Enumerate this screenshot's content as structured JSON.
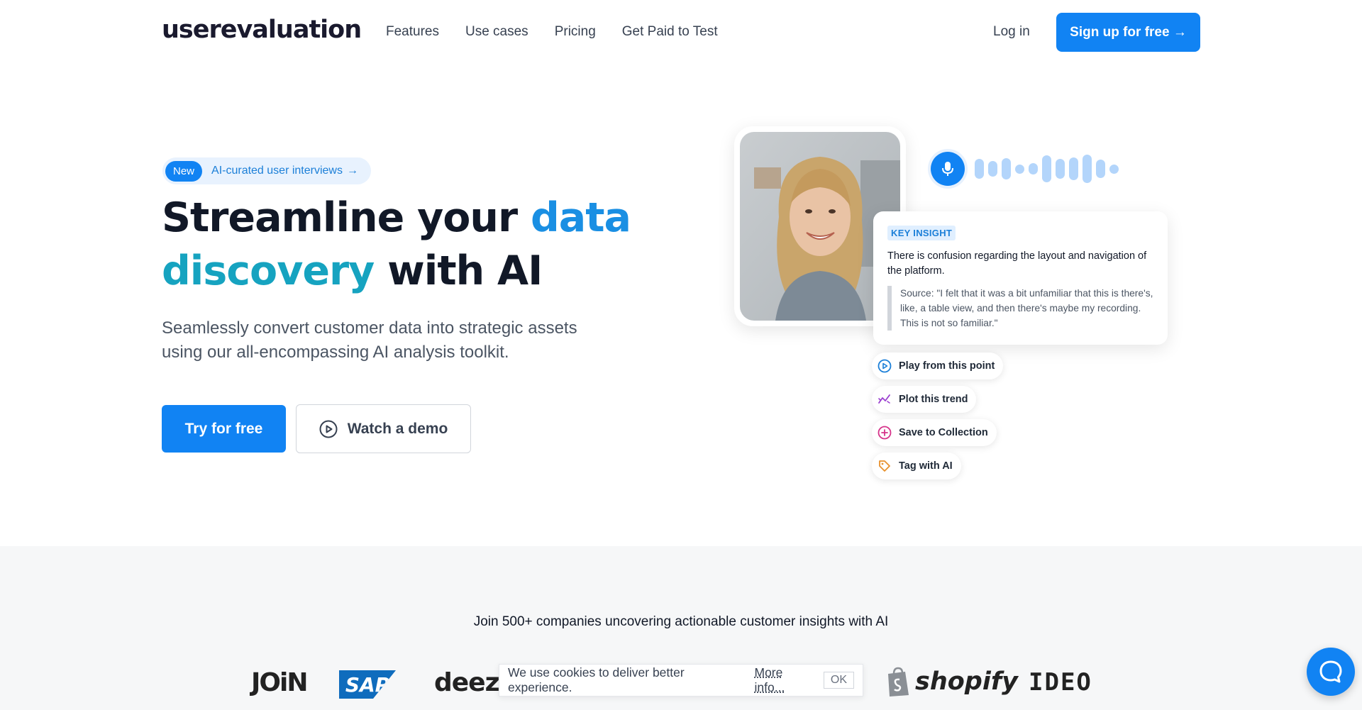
{
  "nav": {
    "logo": "userevaluation",
    "links": [
      "Features",
      "Use cases",
      "Pricing",
      "Get Paid to Test"
    ],
    "login": "Log in",
    "signup": "Sign up for free →"
  },
  "hero": {
    "badge_new": "New",
    "badge_text": "AI-curated user interviews",
    "headline_1": "Streamline your ",
    "headline_2": "data",
    "headline_3": "discovery",
    "headline_4": " with AI",
    "subtext": "Seamlessly convert customer data into strategic assets using our all-encompassing AI analysis toolkit.",
    "try_button": "Try for free",
    "demo_button": "Watch a demo"
  },
  "insight": {
    "tag": "KEY INSIGHT",
    "title": "There is confusion regarding the layout and navigation of the platform.",
    "quote": "Source: \"I felt that it was a bit unfamiliar that this is there's, like, a table view, and then there's maybe my recording. This is not so familiar.\""
  },
  "actions": [
    {
      "label": "Play from this point",
      "icon": "play-circle-icon",
      "color": "#1b7fd8"
    },
    {
      "label": "Plot this trend",
      "icon": "trend-icon",
      "color": "#9b3fd0"
    },
    {
      "label": "Save to Collection",
      "icon": "plus-circle-icon",
      "color": "#d6338a"
    },
    {
      "label": "Tag with AI",
      "icon": "tag-icon",
      "color": "#e8912e"
    }
  ],
  "social_proof": {
    "text": "Join 500+ companies uncovering actionable customer insights with AI",
    "logos": [
      "JOiN",
      "SAP",
      "deezer",
      "shopify",
      "IDEO"
    ]
  },
  "cookie": {
    "text": "We use cookies to deliver better experience.",
    "more": "More info...",
    "ok": "OK"
  },
  "colors": {
    "primary": "#1183f3",
    "accent_data": "#1a8fe3",
    "accent_discovery": "#16a3c0"
  }
}
